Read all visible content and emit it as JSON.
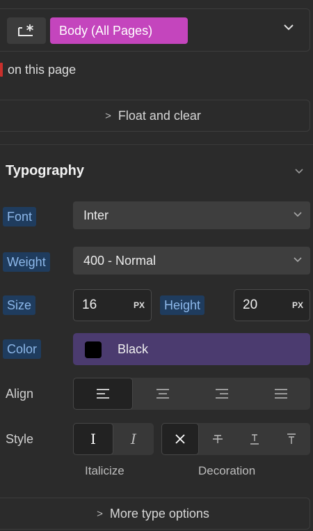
{
  "selector": {
    "icon": "element-selector-icon",
    "tag": "Body (All Pages)"
  },
  "on_page_text": "on this page",
  "float_section": {
    "label": "Float and clear"
  },
  "typography": {
    "title": "Typography",
    "font": {
      "label": "Font",
      "value": "Inter"
    },
    "weight": {
      "label": "Weight",
      "value": "400 - Normal"
    },
    "size": {
      "label": "Size",
      "value": "16",
      "unit": "PX"
    },
    "height": {
      "label": "Height",
      "value": "20",
      "unit": "PX"
    },
    "color": {
      "label": "Color",
      "value": "Black",
      "swatch": "#000000"
    },
    "align": {
      "label": "Align",
      "options": [
        "align-left-icon",
        "align-center-icon",
        "align-right-icon",
        "align-justify-icon"
      ],
      "active": "align-left-icon"
    },
    "style": {
      "label": "Style",
      "italic_options": [
        "I",
        "I"
      ],
      "decoration_options": [
        "decoration-none-icon",
        "strikethrough-icon",
        "underline-icon",
        "overline-icon"
      ],
      "italicize_caption": "Italicize",
      "decoration_caption": "Decoration"
    },
    "more_label": "More type options"
  },
  "colors": {
    "panel": "#2b2b2b",
    "tag_accent": "#c445bd",
    "label_highlight": "#1f3c5e",
    "color_field": "#4b3b6f"
  }
}
